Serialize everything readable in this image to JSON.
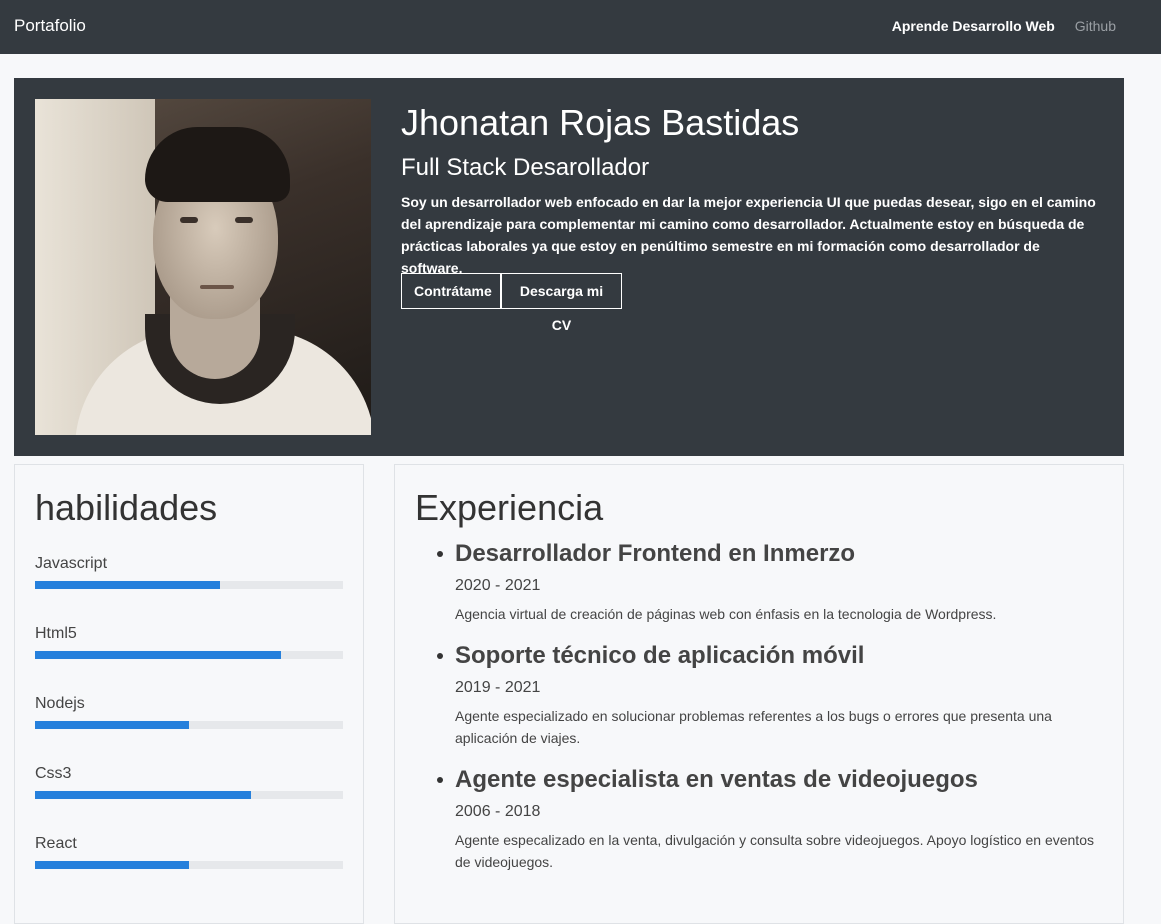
{
  "navbar": {
    "brand": "Portafolio",
    "links": [
      {
        "label": "Aprende Desarrollo Web"
      },
      {
        "label": "Github"
      }
    ]
  },
  "hero": {
    "name": "Jhonatan Rojas Bastidas",
    "role": "Full Stack Desarollador",
    "description": "Soy un desarrollador web enfocado en dar la mejor experiencia UI que puedas desear, sigo en el camino del aprendizaje para complementar mi camino como desarrollador. Actualmente estoy en búsqueda de prácticas laborales ya que estoy en penúltimo semestre en mi formación como desarrollador de software.",
    "buttons": {
      "hire": "Contrátame",
      "cv": "Descarga mi CV"
    }
  },
  "skills": {
    "title": "habilidades",
    "items": [
      {
        "label": "Javascript",
        "level": 0.6
      },
      {
        "label": "Html5",
        "level": 0.8
      },
      {
        "label": "Nodejs",
        "level": 0.5
      },
      {
        "label": "Css3",
        "level": 0.7
      },
      {
        "label": "React",
        "level": 0.5
      }
    ]
  },
  "experience": {
    "title": "Experiencia",
    "items": [
      {
        "title": "Desarrollador Frontend en Inmerzo",
        "years": "2020 - 2021",
        "description": "Agencia virtual de creación de páginas web con énfasis en la tecnologia de Wordpress."
      },
      {
        "title": "Soporte técnico de aplicación móvil",
        "years": "2019 - 2021",
        "description": "Agente especializado en solucionar problemas referentes a los bugs o errores que presenta una aplicación de viajes."
      },
      {
        "title": "Agente especialista en ventas de videojuegos",
        "years": "2006 - 2018",
        "description": "Agente especalizado en la venta, divulgación y consulta sobre videojuegos. Apoyo logístico en eventos de videojuegos."
      }
    ]
  },
  "colors": {
    "navbar": "#343a40",
    "hero": "#343a40",
    "progress": "#2680dc",
    "background": "#f7f8fa"
  }
}
